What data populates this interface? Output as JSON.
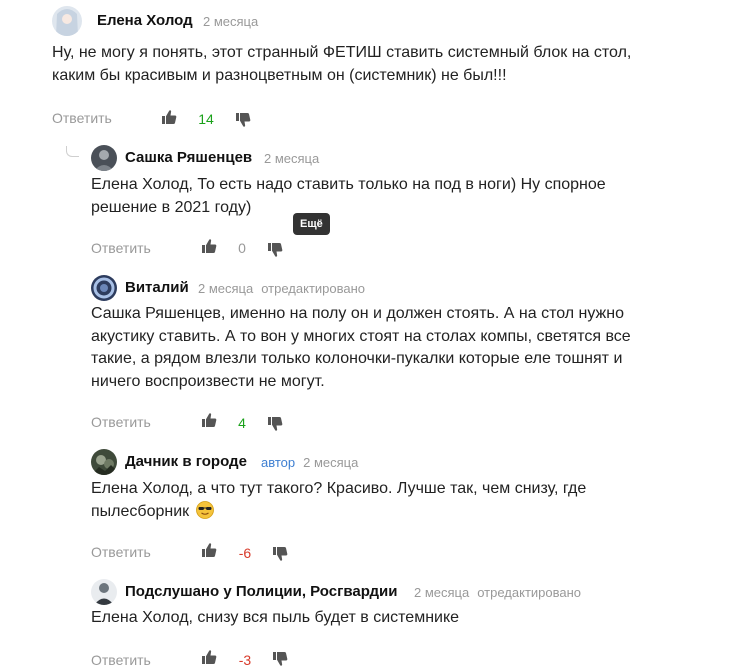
{
  "comments": [
    {
      "name": "Елена Холод",
      "date": "2 месяца",
      "text": "Ну, не могу я понять, этот странный ФЕТИШ ставить системный блок на стол, каким бы красивым и разноцветным он (системник) не был!!!",
      "reply_label": "Ответить",
      "score": "14"
    },
    {
      "name": "Сашка Ряшенцев",
      "date": "2 месяца",
      "text": "Елена Холод, То есть надо ставить только на под в ноги) Ну спорное решение в 2021 году)",
      "reply_label": "Ответить",
      "score": "0"
    },
    {
      "name": "Виталий",
      "date": "2 месяца",
      "edited": "отредактировано",
      "text": "Сашка Ряшенцев, именно на полу он и должен стоять. А на стол нужно акустику ставить. А то вон у многих стоят на столах компы, светятся все такие, а рядом влезли только колоночки-пукалки которые еле тошнят и ничего воспроизвести не могут.",
      "reply_label": "Ответить",
      "score": "4"
    },
    {
      "name": "Дачник в городе",
      "badge": "автор",
      "date": "2 месяца",
      "text": "Елена Холод, а что тут такого? Красиво. Лучше так, чем снизу, где пылесборник",
      "reply_label": "Ответить",
      "score": "-6"
    },
    {
      "name": "Подслушано у Полиции, Росгвардии",
      "date": "2 месяца",
      "edited": "отредактировано",
      "text": "Елена Холод, снизу вся пыль будет в системнике",
      "reply_label": "Ответить",
      "score": "-3"
    }
  ],
  "tooltip": "Ещё",
  "icons": {
    "like": "thumbs-up-icon",
    "dislike": "thumbs-down-icon",
    "emoji": "sunglasses-emoji-icon"
  },
  "colors": {
    "positive": "#1aa11a",
    "negative": "#d83a2a",
    "author_badge": "#3e7fd1",
    "muted": "#999999"
  }
}
